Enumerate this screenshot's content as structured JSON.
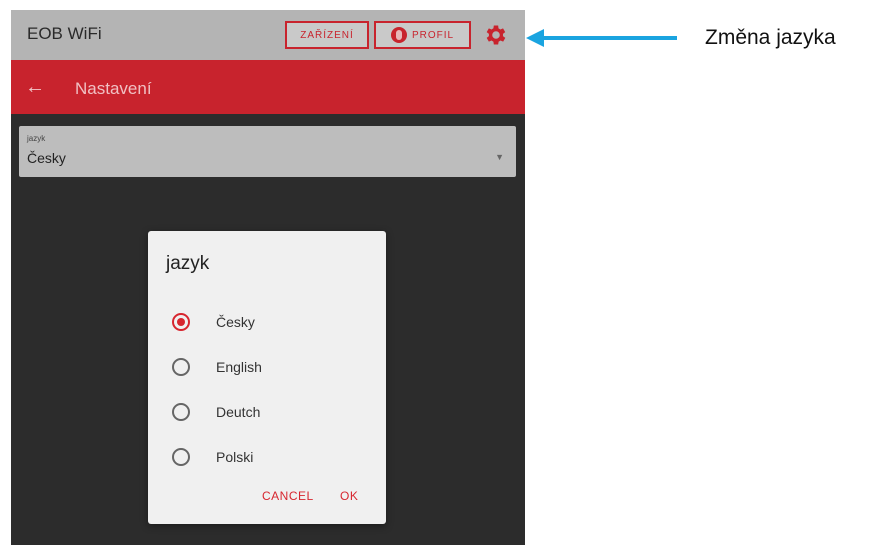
{
  "app": {
    "title": "EOB WiFi",
    "devices_label": "ZAŘÍZENÍ",
    "profile_label": "PROFIL",
    "settings_icon": "gear-icon",
    "accent_color": "#c8232d"
  },
  "nav": {
    "back_icon": "arrow-left-icon",
    "title": "Nastavení"
  },
  "language_field": {
    "label": "jazyk",
    "value": "Česky"
  },
  "dialog": {
    "title": "jazyk",
    "options": [
      {
        "label": "Česky",
        "selected": true
      },
      {
        "label": "English",
        "selected": false
      },
      {
        "label": "Deutch",
        "selected": false
      },
      {
        "label": "Polski",
        "selected": false
      }
    ],
    "cancel_label": "CANCEL",
    "ok_label": "OK"
  },
  "annotation": {
    "text": "Změna jazyka",
    "arrow_color": "#1aa4e0"
  }
}
